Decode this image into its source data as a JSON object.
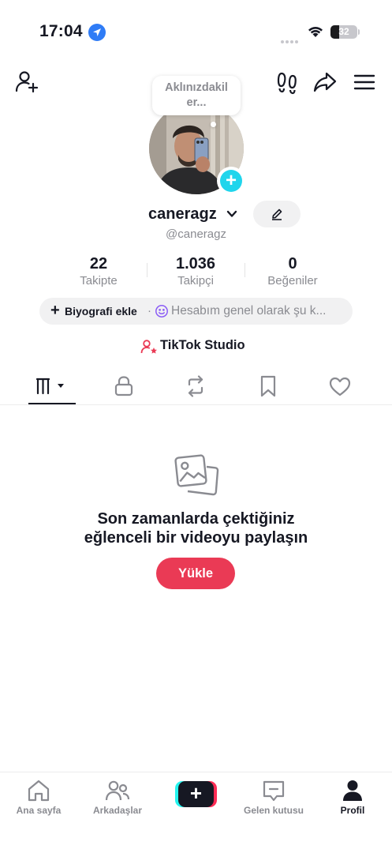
{
  "status_bar": {
    "time": "17:04",
    "battery": "32",
    "battery_level": 0.32
  },
  "header": {
    "icons": [
      "add-friend-icon",
      "footprints-icon",
      "share-icon",
      "menu-icon"
    ]
  },
  "profile": {
    "thought_bubble": "Aklınızdakiler...",
    "username": "caneragz",
    "handle": "@caneragz",
    "stats": [
      {
        "value": "22",
        "label": "Takipte"
      },
      {
        "value": "1.036",
        "label": "Takipçi"
      },
      {
        "value": "0",
        "label": "Beğeniler"
      }
    ],
    "bio_add": "Biyografi ekle",
    "bio_separator": "·",
    "bio_text": "Hesabım genel olarak şu k...",
    "studio": "TikTok Studio"
  },
  "tabs": [
    "videos-grid-icon",
    "lock-icon",
    "repost-icon",
    "bookmark-icon",
    "heart-icon"
  ],
  "empty_state": {
    "title_line1": "Son zamanlarda çektiğiniz",
    "title_line2": "eğlenceli bir videoyu paylaşın",
    "button": "Yükle"
  },
  "bottom_nav": {
    "items": [
      {
        "label": "Ana sayfa",
        "icon": "home-icon"
      },
      {
        "label": "Arkadaşlar",
        "icon": "friends-icon"
      },
      {
        "label": "",
        "icon": "create-icon"
      },
      {
        "label": "Gelen kutusu",
        "icon": "inbox-icon"
      },
      {
        "label": "Profil",
        "icon": "profile-icon"
      }
    ],
    "active": "Profil"
  },
  "colors": {
    "accent": "#ea3a55",
    "cyan": "#20d5ec",
    "text_primary": "#161823",
    "text_secondary": "#8a8b91"
  }
}
